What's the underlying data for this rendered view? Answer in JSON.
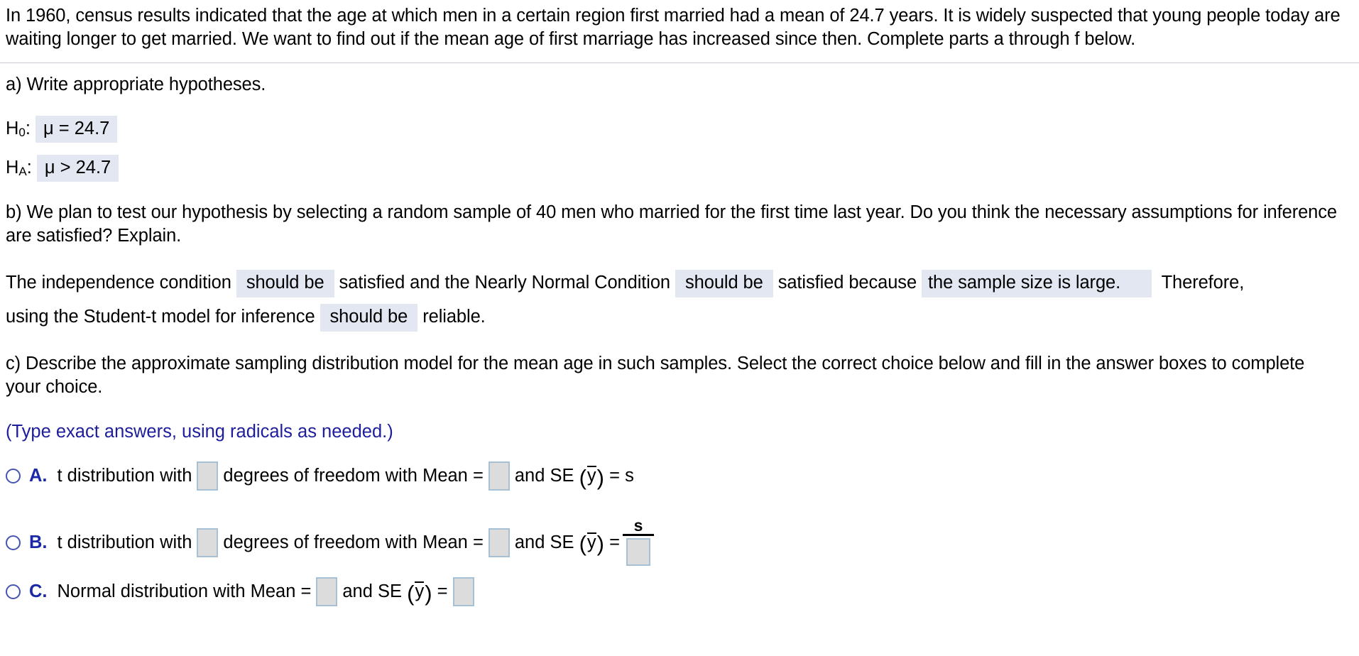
{
  "problem": {
    "intro": "In 1960, census results indicated that the age at which men in a certain region first married had a mean of 24.7 years. It is widely suspected that young people today are waiting longer to get married. We want to find out if the mean age of first marriage has increased since then. Complete parts a through f below."
  },
  "part_a": {
    "prompt": "a) Write appropriate hypotheses.",
    "null_label": "H",
    "null_sub": "0",
    "null_colon": ":",
    "null_value": "μ = 24.7",
    "alt_label": "H",
    "alt_sub": "A",
    "alt_colon": ":",
    "alt_value": "μ > 24.7"
  },
  "part_b": {
    "prompt": "b) We plan to test our hypothesis by selecting a random sample of 40 men who married for the first time last year. Do you think the necessary assumptions for inference are satisfied? Explain.",
    "line1_seg1": "The independence condition",
    "dropdown1": "should be",
    "line1_seg2": "satisfied and the Nearly Normal Condition",
    "dropdown2": "should be",
    "line1_seg3": "satisfied because",
    "dropdown3": "the sample size is large.",
    "line1_seg4": "Therefore,",
    "line2_seg1": "using the Student-t model for inference",
    "dropdown4": "should be",
    "line2_seg2": "reliable."
  },
  "part_c": {
    "prompt": "c) Describe the approximate sampling distribution model for the mean age in such samples. Select the correct choice below and fill in the answer boxes to complete your choice.",
    "hint": "(Type exact answers, using radicals as needed.)",
    "choices": [
      {
        "letter": "A.",
        "selected": false,
        "seg1": "t distribution with",
        "seg2": "degrees of freedom with Mean =",
        "seg3": "and SE",
        "var": "y",
        "seg4": "= s",
        "box1": "",
        "box2": "",
        "box3": ""
      },
      {
        "letter": "B.",
        "selected": false,
        "seg1": "t distribution with",
        "seg2": "degrees of freedom with Mean =",
        "seg3": "and SE",
        "var": "y",
        "seg4": "=",
        "numerator": "s",
        "box1": "",
        "box2": "",
        "box3": ""
      },
      {
        "letter": "C.",
        "selected": false,
        "seg1": "Normal distribution with Mean =",
        "seg2": "and SE",
        "var": "y",
        "seg3": "=",
        "box1": "",
        "box2": ""
      }
    ]
  },
  "colors": {
    "highlight": "#e2e7f2",
    "hint_blue": "#1d1d9e",
    "choice_blue": "#1b29a8",
    "radio_blue": "#4655b4",
    "box_fill": "#dcdcdc",
    "box_border": "#a7c0d3",
    "divider": "#c9cbd2"
  }
}
